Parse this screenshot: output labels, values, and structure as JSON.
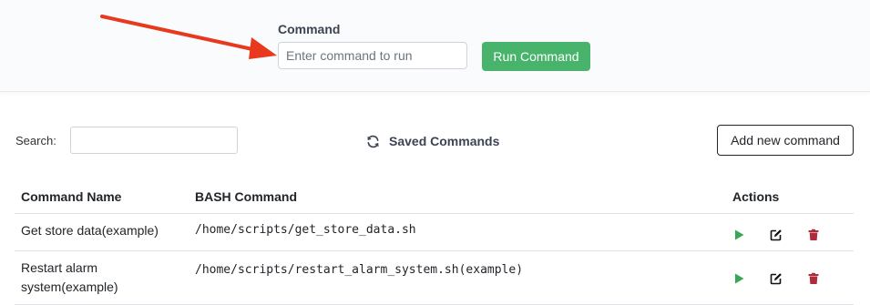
{
  "command_panel": {
    "label": "Command",
    "input_placeholder": "Enter command to run",
    "run_button": "Run Command"
  },
  "toolbar": {
    "search_label": "Search:",
    "search_value": "",
    "saved_title": "Saved Commands",
    "add_button": "Add new command"
  },
  "table": {
    "headers": {
      "name": "Command Name",
      "bash": "BASH Command",
      "actions": "Actions"
    },
    "rows": [
      {
        "name": "Get store data(example)",
        "bash": "/home/scripts/get_store_data.sh"
      },
      {
        "name": "Restart alarm system(example)",
        "bash": "/home/scripts/restart_alarm_system.sh(example)"
      }
    ]
  },
  "icons": {
    "refresh": "refresh-icon",
    "run": "play-icon",
    "edit": "edit-icon",
    "delete": "trash-icon",
    "annotation_arrow": "red-arrow"
  },
  "colors": {
    "run_button": "#48b46b",
    "play_icon": "#3aa757",
    "delete_icon": "#b02a37",
    "arrow": "#e8391f"
  }
}
